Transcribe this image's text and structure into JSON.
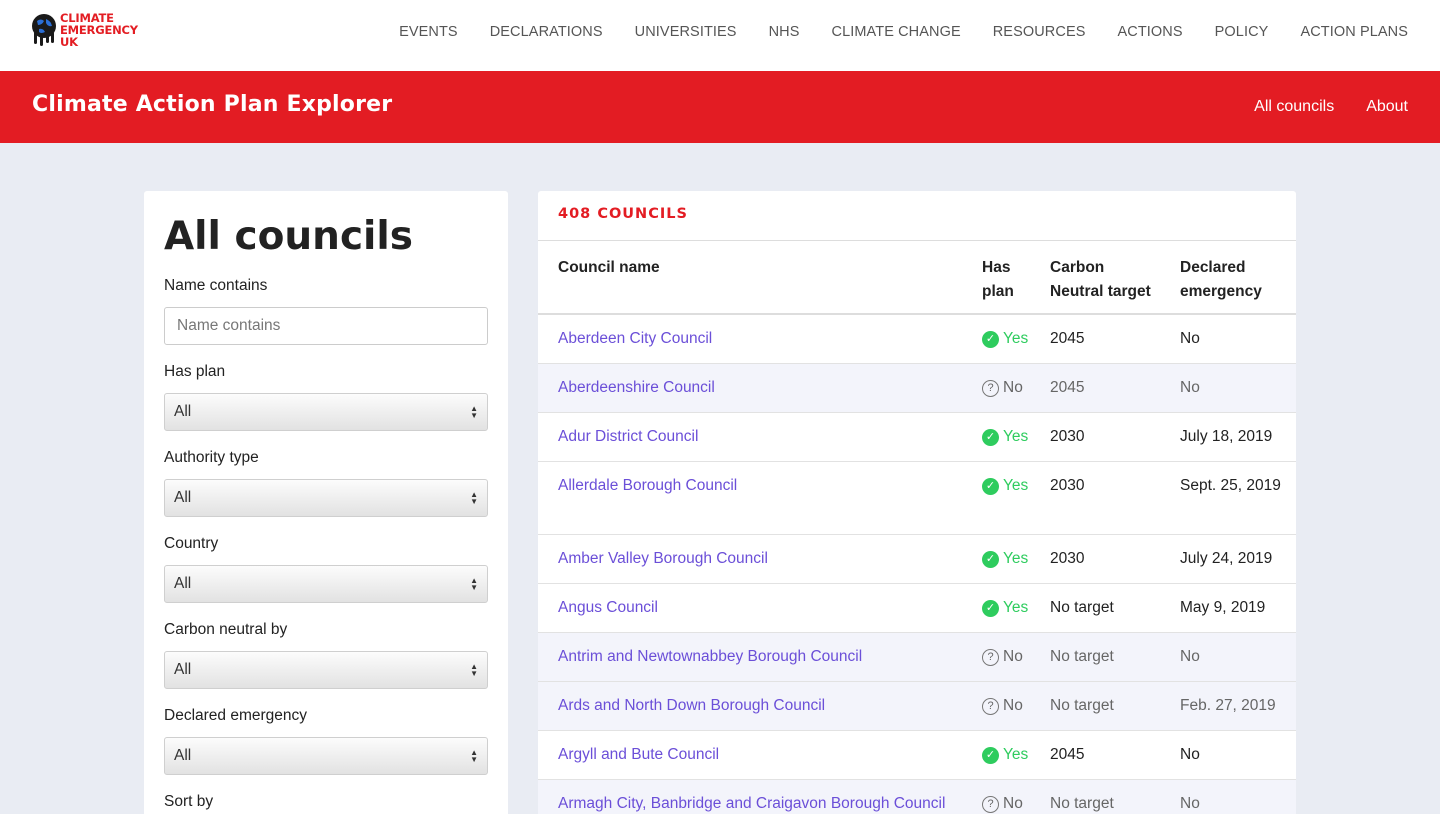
{
  "logo": {
    "line1": "CLIMATE",
    "line2": "EMERGENCY",
    "line3": "UK"
  },
  "nav": [
    "EVENTS",
    "DECLARATIONS",
    "UNIVERSITIES",
    "NHS",
    "CLIMATE CHANGE",
    "RESOURCES",
    "ACTIONS",
    "POLICY",
    "ACTION PLANS"
  ],
  "banner": {
    "title": "Climate Action Plan Explorer",
    "links": [
      "All councils",
      "About"
    ]
  },
  "filters": {
    "heading": "All councils",
    "name_label": "Name contains",
    "name_placeholder": "Name contains",
    "has_plan": {
      "label": "Has plan",
      "value": "All"
    },
    "authority_type": {
      "label": "Authority type",
      "value": "All"
    },
    "country": {
      "label": "Country",
      "value": "All"
    },
    "carbon_neutral_by": {
      "label": "Carbon neutral by",
      "value": "All"
    },
    "declared_emergency": {
      "label": "Declared emergency",
      "value": "All"
    },
    "sort_by": {
      "label": "Sort by"
    }
  },
  "results": {
    "count_label": "408 COUNCILS",
    "headers": {
      "name": "Council name",
      "plan_1": "Has",
      "plan_2": "plan",
      "carbon_1": "Carbon",
      "carbon_2": "Neutral target",
      "declared_1": "Declared",
      "declared_2": "emergency"
    },
    "rows": [
      {
        "name": "Aberdeen City Council",
        "plan": "Yes",
        "carbon": "2045",
        "declared": "No"
      },
      {
        "name": "Aberdeenshire Council",
        "plan": "No",
        "carbon": "2045",
        "declared": "No"
      },
      {
        "name": "Adur District Council",
        "plan": "Yes",
        "carbon": "2030",
        "declared": "July 18, 2019"
      },
      {
        "name": "Allerdale Borough Council",
        "plan": "Yes",
        "carbon": "2030",
        "declared": "Sept. 25, 2019"
      },
      {
        "name": "Amber Valley Borough Council",
        "plan": "Yes",
        "carbon": "2030",
        "declared": "July 24, 2019"
      },
      {
        "name": "Angus Council",
        "plan": "Yes",
        "carbon": "No target",
        "declared": "May 9, 2019"
      },
      {
        "name": "Antrim and Newtownabbey Borough Council",
        "plan": "No",
        "carbon": "No target",
        "declared": "No"
      },
      {
        "name": "Ards and North Down Borough Council",
        "plan": "No",
        "carbon": "No target",
        "declared": "Feb. 27, 2019"
      },
      {
        "name": "Argyll and Bute Council",
        "plan": "Yes",
        "carbon": "2045",
        "declared": "No"
      },
      {
        "name": "Armagh City, Banbridge and Craigavon Borough Council",
        "plan": "No",
        "carbon": "No target",
        "declared": "No"
      }
    ]
  },
  "colors": {
    "brand_red": "#e31c23",
    "link_purple": "#6b4fd8",
    "yes_green": "#2ecc5e"
  }
}
